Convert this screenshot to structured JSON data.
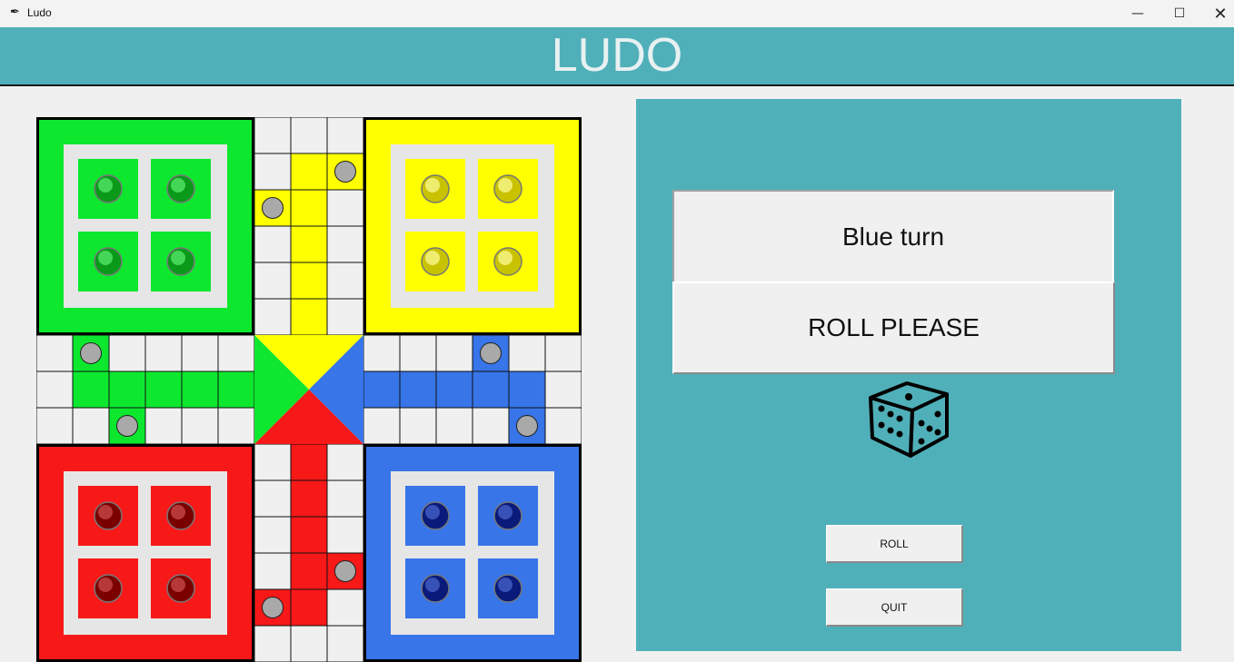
{
  "window": {
    "title": "Ludo",
    "icon": "feather-icon",
    "controls": [
      "minimize-icon",
      "maximize-icon",
      "close-icon"
    ]
  },
  "header": {
    "title": "LUDO"
  },
  "colors": {
    "green": "#0de82e",
    "yellow": "#ffff00",
    "red": "#f71818",
    "blue": "#3775e8",
    "teal": "#50b0b9",
    "token_grey": "#a9a9a9"
  },
  "status": {
    "turn_text": "Blue turn",
    "message": "ROLL PLEASE"
  },
  "controls": {
    "roll_label": "ROLL",
    "quit_label": "QUIT"
  },
  "dice": {
    "icon": "dice-icon"
  }
}
